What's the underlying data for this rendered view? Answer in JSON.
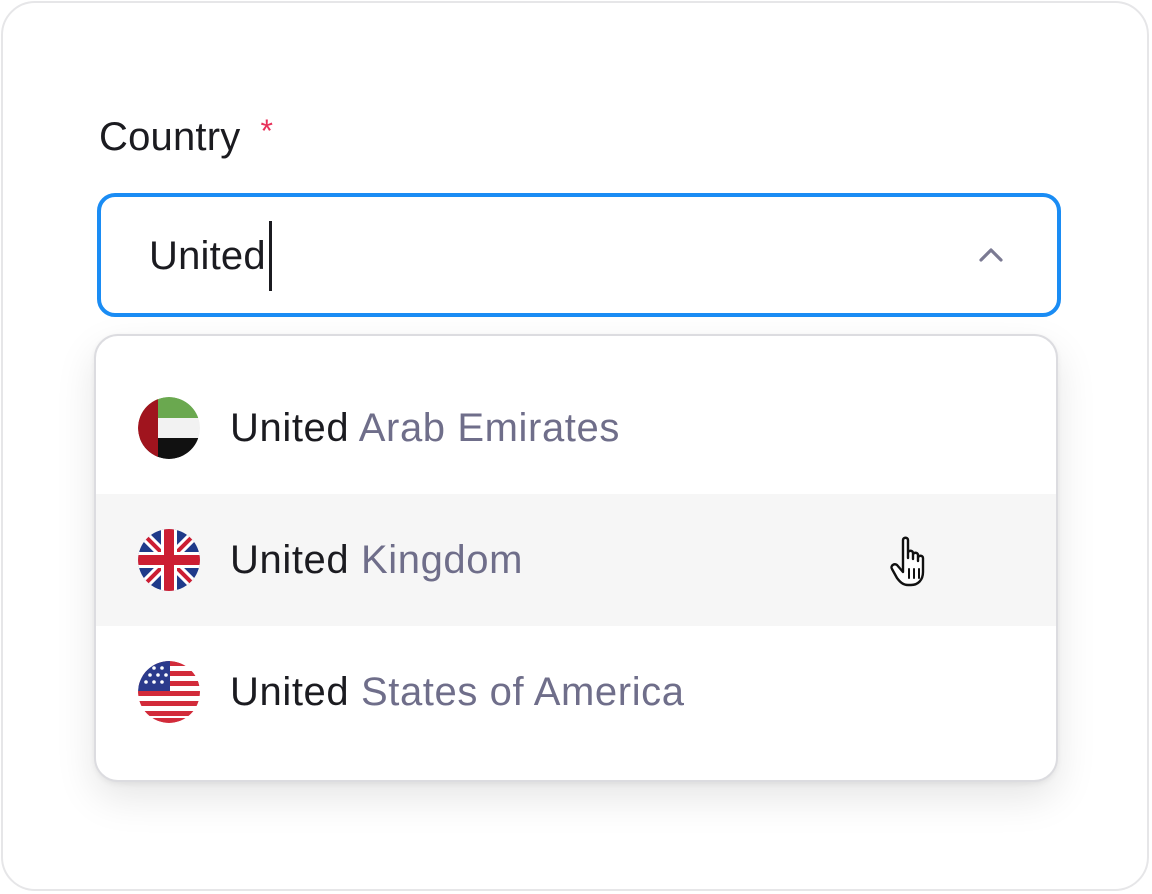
{
  "field": {
    "label": "Country",
    "required_marker": "*"
  },
  "search": {
    "value": "United",
    "state": "focused",
    "toggle_icon": "chevron-up-icon"
  },
  "options": [
    {
      "match": "United",
      "rest": "Arab Emirates",
      "flag_icon": "uae-flag-icon",
      "hovered": false
    },
    {
      "match": "United",
      "rest": "Kingdom",
      "flag_icon": "uk-flag-icon",
      "hovered": true
    },
    {
      "match": "United",
      "rest": "States of America",
      "flag_icon": "usa-flag-icon",
      "hovered": false
    }
  ],
  "colors": {
    "focus_border": "#1a8cf4",
    "required": "#e8315a",
    "match_text": "#1b1b20",
    "rest_text": "#6f6e8a",
    "hover_background": "#f6f6f6"
  },
  "cursor_icon": "hand-pointer-icon"
}
